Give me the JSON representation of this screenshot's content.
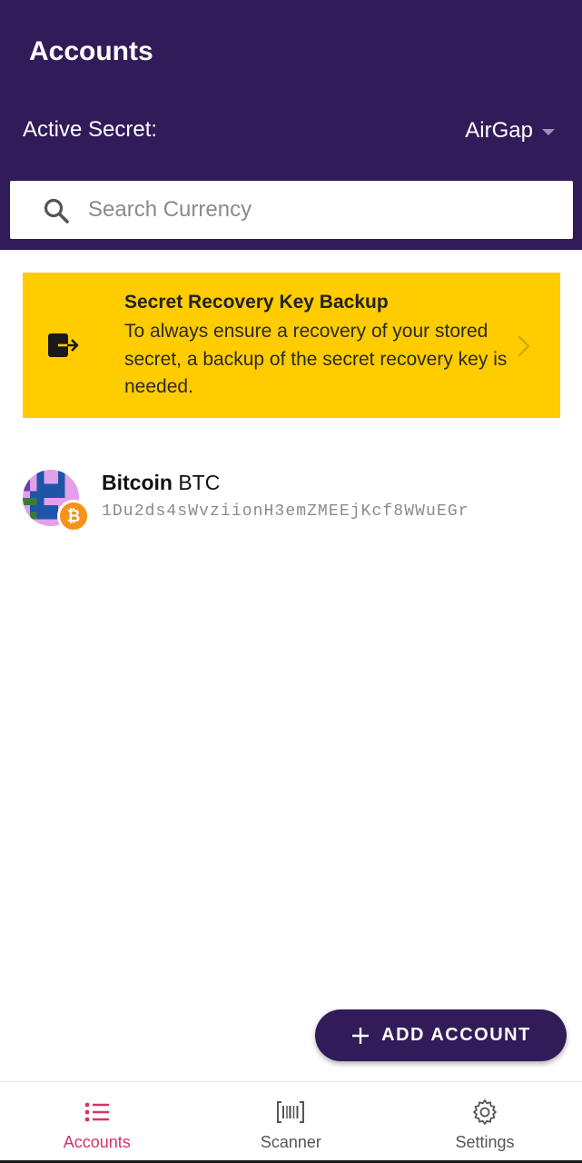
{
  "header": {
    "title": "Accounts",
    "active_secret_label": "Active Secret:",
    "active_secret_value": "AirGap"
  },
  "search": {
    "placeholder": "Search Currency",
    "value": ""
  },
  "banner": {
    "title": "Secret Recovery Key Backup",
    "text": "To always ensure a recovery of your stored secret, a backup of the secret recovery key is needed."
  },
  "accounts": [
    {
      "name": "Bitcoin",
      "symbol": "BTC",
      "address": "1Du2ds4sWvziionH3emZMEEjKcf8WWuEGr",
      "badge_glyph": "₿"
    }
  ],
  "add_account": {
    "label": "ADD ACCOUNT"
  },
  "tabs": [
    {
      "label": "Accounts",
      "icon": "list-icon",
      "active": true
    },
    {
      "label": "Scanner",
      "icon": "barcode-icon",
      "active": false
    },
    {
      "label": "Settings",
      "icon": "gear-icon",
      "active": false
    }
  ],
  "colors": {
    "header_bg": "#311b58",
    "banner_bg": "#ffcc00",
    "accent": "#d6336c",
    "btc_orange": "#f7931a"
  }
}
